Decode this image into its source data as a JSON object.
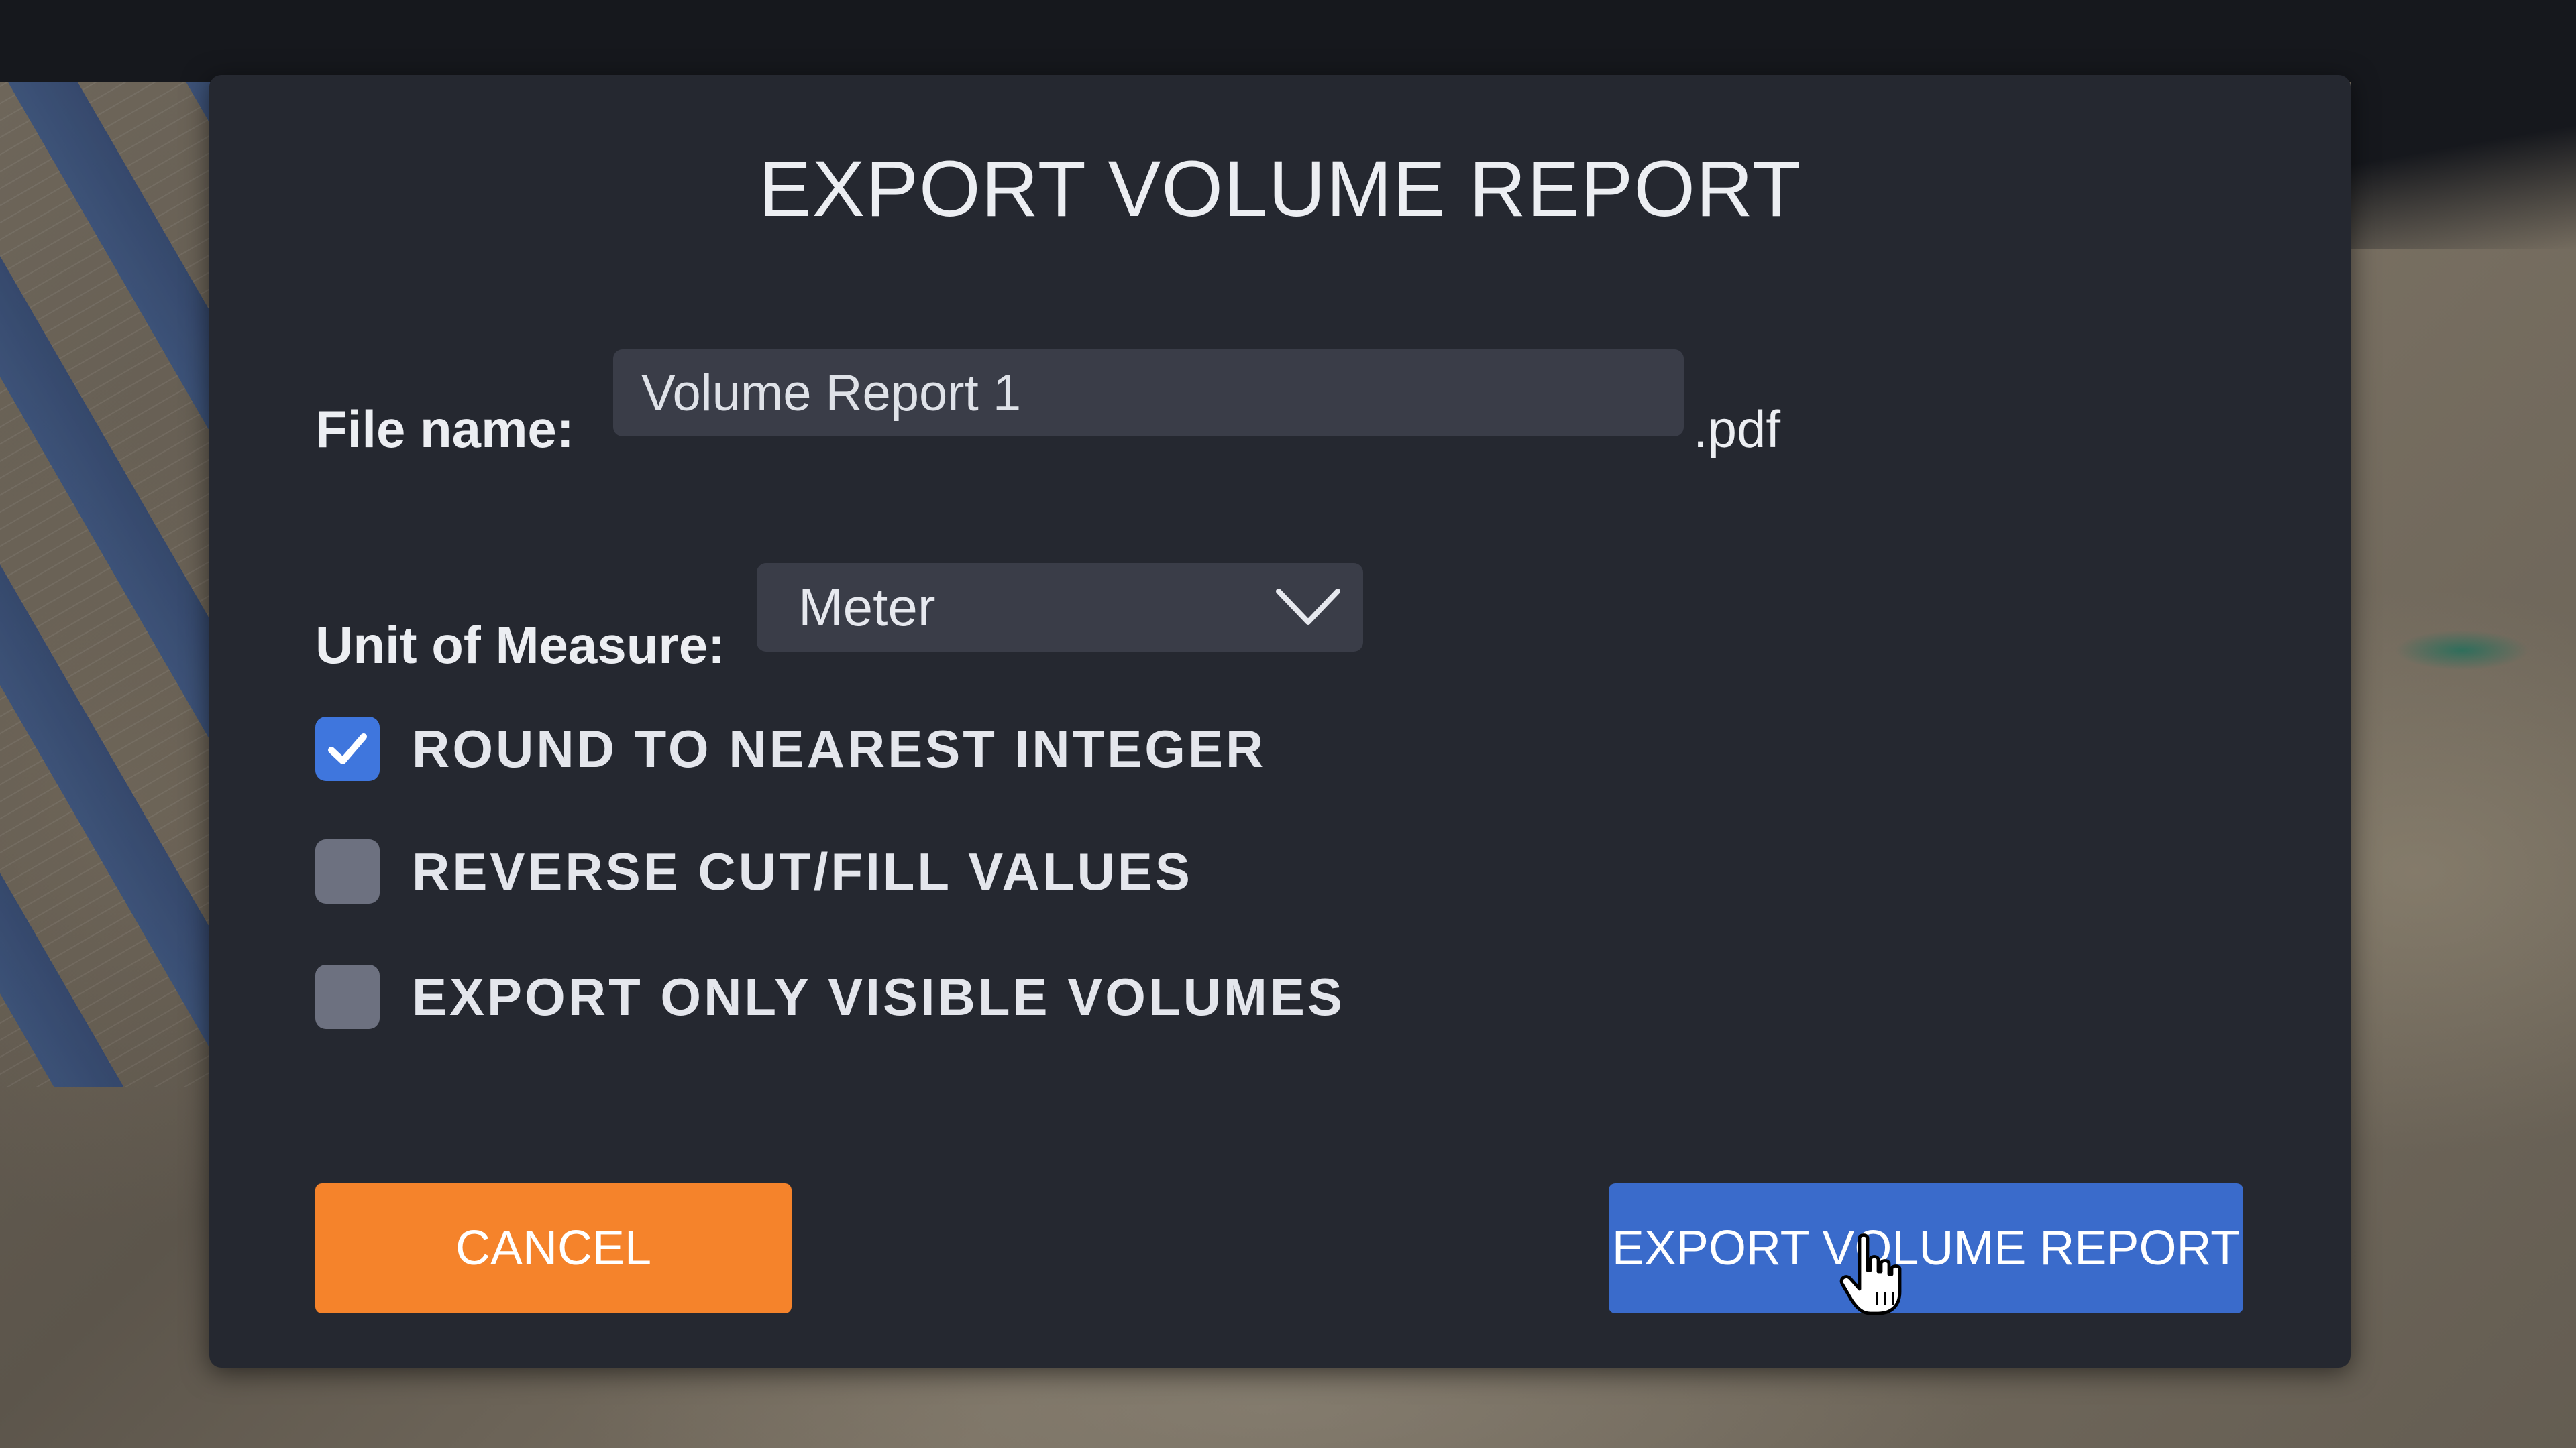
{
  "dialog": {
    "title": "EXPORT VOLUME REPORT",
    "file_name_label": "File name:",
    "file_name_value": "Volume Report 1",
    "file_extension": ".pdf",
    "unit_label": "Unit of Measure:",
    "unit_selected": "Meter",
    "options": [
      {
        "label": "ROUND TO NEAREST INTEGER",
        "checked": true
      },
      {
        "label": "REVERSE CUT/FILL VALUES",
        "checked": false
      },
      {
        "label": "EXPORT ONLY VISIBLE VOLUMES",
        "checked": false
      }
    ],
    "cancel_label": "CANCEL",
    "export_label": "EXPORT VOLUME REPORT"
  },
  "icons": {
    "dropdown": "chevron-down-icon",
    "check": "checkmark-icon",
    "cursor": "hand-pointer-icon"
  },
  "colors": {
    "dialog_bg": "#252830",
    "input_bg": "#3a3d48",
    "checkbox_checked": "#3f76dd",
    "checkbox_unchecked": "#6d7180",
    "cancel_button": "#f5832b",
    "export_button": "#3a6bcb"
  }
}
